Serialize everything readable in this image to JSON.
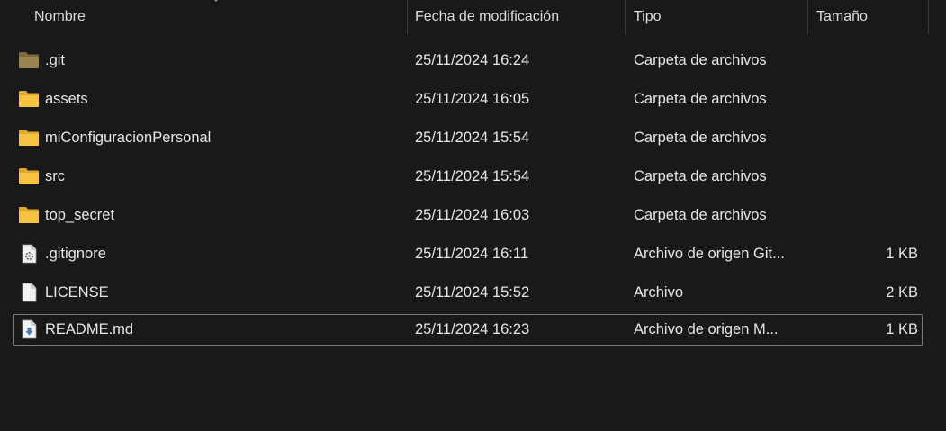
{
  "columns": {
    "name": "Nombre",
    "date": "Fecha de modificación",
    "type": "Tipo",
    "size": "Tamaño"
  },
  "rows": [
    {
      "name": ".git",
      "date": "25/11/2024 16:24",
      "type": "Carpeta de archivos",
      "size": "",
      "icon": "folder-dim-icon"
    },
    {
      "name": "assets",
      "date": "25/11/2024 16:05",
      "type": "Carpeta de archivos",
      "size": "",
      "icon": "folder-icon"
    },
    {
      "name": "miConfiguracionPersonal",
      "date": "25/11/2024 15:54",
      "type": "Carpeta de archivos",
      "size": "",
      "icon": "folder-icon"
    },
    {
      "name": "src",
      "date": "25/11/2024 15:54",
      "type": "Carpeta de archivos",
      "size": "",
      "icon": "folder-icon"
    },
    {
      "name": "top_secret",
      "date": "25/11/2024 16:03",
      "type": "Carpeta de archivos",
      "size": "",
      "icon": "folder-icon"
    },
    {
      "name": ".gitignore",
      "date": "25/11/2024 16:11",
      "type": "Archivo de origen Git...",
      "size": "1 KB",
      "icon": "settings-file-icon"
    },
    {
      "name": "LICENSE",
      "date": "25/11/2024 15:52",
      "type": "Archivo",
      "size": "2 KB",
      "icon": "file-icon"
    },
    {
      "name": "README.md",
      "date": "25/11/2024 16:23",
      "type": "Archivo de origen M...",
      "size": "1 KB",
      "icon": "markdown-file-icon"
    }
  ],
  "colors": {
    "background": "#191919",
    "folder": "#f5c342",
    "selection_border": "#7a7a7a"
  }
}
